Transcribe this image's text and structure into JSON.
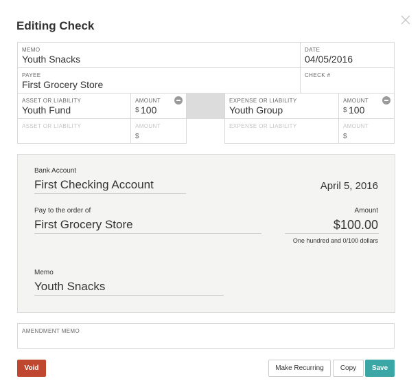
{
  "dialog": {
    "title": "Editing Check"
  },
  "form": {
    "memo": {
      "label": "MEMO",
      "value": "Youth Snacks"
    },
    "date": {
      "label": "DATE",
      "value": "04/05/2016"
    },
    "payee": {
      "label": "PAYEE",
      "value": "First Grocery Store"
    },
    "check_number": {
      "label": "CHECK #",
      "value": ""
    },
    "split_rows": [
      {
        "asset_label": "ASSET OR LIABILITY",
        "asset_value": "Youth Fund",
        "asset_amount_label": "AMOUNT",
        "asset_currency": "$",
        "asset_amount": "100",
        "expense_label": "EXPENSE OR LIABILITY",
        "expense_value": "Youth Group",
        "expense_amount_label": "AMOUNT",
        "expense_currency": "$",
        "expense_amount": "100"
      },
      {
        "asset_label": "ASSET OR LIABILITY",
        "asset_value": "",
        "asset_amount_label": "AMOUNT",
        "asset_currency": "$",
        "asset_amount": "",
        "expense_label": "EXPENSE OR LIABILITY",
        "expense_value": "",
        "expense_amount_label": "AMOUNT",
        "expense_currency": "$",
        "expense_amount": ""
      }
    ]
  },
  "check_preview": {
    "bank_account_label": "Bank Account",
    "bank_account": "First Checking Account",
    "date": "April 5, 2016",
    "pay_to_label": "Pay to the order of",
    "payee": "First Grocery Store",
    "amount_label": "Amount",
    "amount": "$100.00",
    "amount_words": "One hundred and 0/100 dollars",
    "memo_label": "Memo",
    "memo": "Youth Snacks"
  },
  "amendment_memo": {
    "label": "AMENDMENT MEMO",
    "value": ""
  },
  "buttons": {
    "void": "Void",
    "make_recurring": "Make Recurring",
    "copy": "Copy",
    "save": "Save"
  },
  "colors": {
    "void": "#c0472f",
    "save": "#3aa6a6",
    "check_bg": "#f4f4f2"
  }
}
